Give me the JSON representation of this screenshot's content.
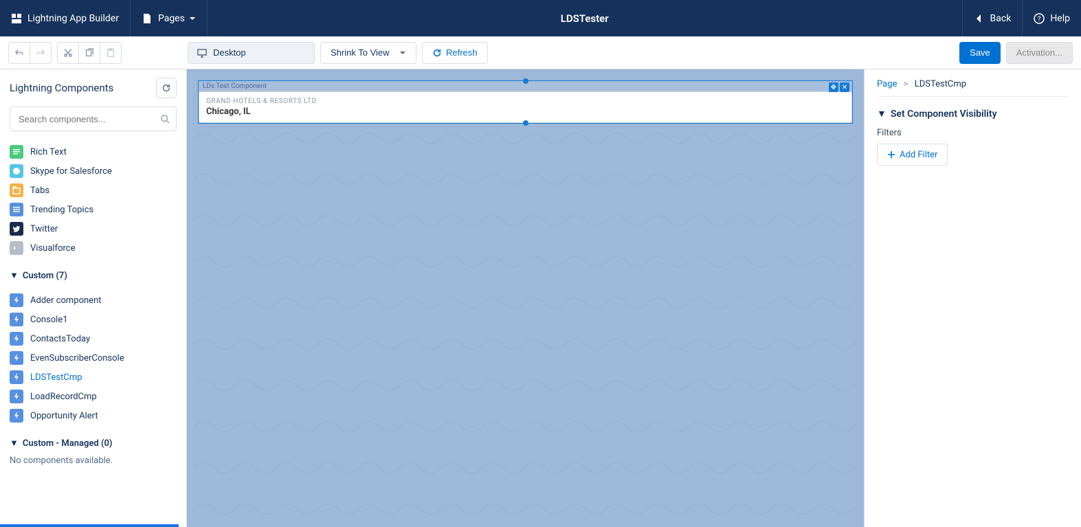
{
  "header": {
    "app_title": "Lightning App Builder",
    "pages_label": "Pages",
    "page_title": "LDSTester",
    "back_label": "Back",
    "help_label": "Help"
  },
  "toolbar": {
    "device_label": "Desktop",
    "zoom_label": "Shrink To View",
    "refresh_label": "Refresh",
    "save_label": "Save",
    "activation_label": "Activation..."
  },
  "left_panel": {
    "title": "Lightning Components",
    "search_placeholder": "Search components...",
    "standard_components": [
      {
        "label": "Rich Text",
        "icon": "richtext"
      },
      {
        "label": "Skype for Salesforce",
        "icon": "skype"
      },
      {
        "label": "Tabs",
        "icon": "tabs"
      },
      {
        "label": "Trending Topics",
        "icon": "topics"
      },
      {
        "label": "Twitter",
        "icon": "twitter"
      },
      {
        "label": "Visualforce",
        "icon": "vf"
      }
    ],
    "custom_section_label": "Custom (7)",
    "custom_components": [
      {
        "label": "Adder component"
      },
      {
        "label": "Console1"
      },
      {
        "label": "ContactsToday"
      },
      {
        "label": "EvenSubscriberConsole"
      },
      {
        "label": "LDSTestCmp",
        "active": true
      },
      {
        "label": "LoadRecordCmp"
      },
      {
        "label": "Opportunity Alert"
      }
    ],
    "managed_section_label": "Custom - Managed (0)",
    "managed_empty_msg": "No components available."
  },
  "canvas": {
    "component_tag": "LDs Test Component",
    "card_title": "GRAND HOTELS & RESORTS LTD",
    "card_subtitle": "Chicago, IL"
  },
  "right_panel": {
    "breadcrumb_root": "Page",
    "breadcrumb_current": "LDSTestCmp",
    "section_title": "Set Component Visibility",
    "filters_label": "Filters",
    "add_filter_label": "Add Filter"
  }
}
